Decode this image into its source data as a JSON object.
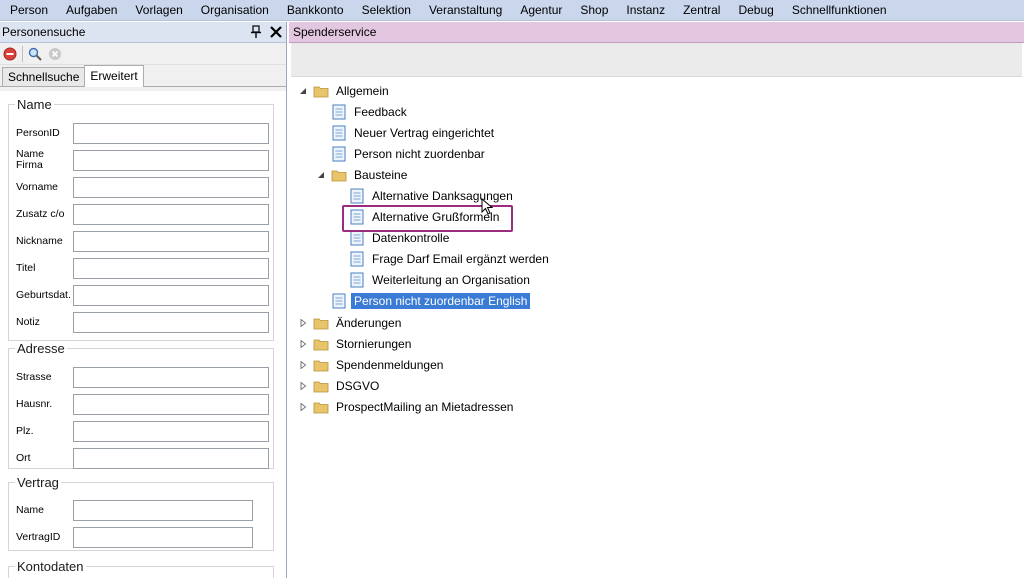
{
  "menu": [
    "Person",
    "Aufgaben",
    "Vorlagen",
    "Organisation",
    "Bankkonto",
    "Selektion",
    "Veranstaltung",
    "Agentur",
    "Shop",
    "Instanz",
    "Zentral",
    "Debug",
    "Schnellfunktionen"
  ],
  "left_panel": {
    "title": "Personensuche",
    "tabs": [
      "Schnellsuche",
      "Erweitert"
    ],
    "active_tab": "Erweitert",
    "groups": {
      "name": {
        "legend": "Name",
        "fields": [
          "PersonID",
          "Name Firma",
          "Vorname",
          "Zusatz c/o",
          "Nickname",
          "Titel",
          "Geburtsdat.",
          "Notiz"
        ]
      },
      "adresse": {
        "legend": "Adresse",
        "fields": [
          "Strasse",
          "Hausnr.",
          "Plz.",
          "Ort"
        ]
      },
      "vertrag": {
        "legend": "Vertrag",
        "fields": [
          "Name",
          "VertragID"
        ]
      },
      "kontodaten": {
        "legend": "Kontodaten"
      }
    }
  },
  "right_panel": {
    "title": "Spenderservice",
    "tree": {
      "allgemein": "Allgemein",
      "feedback": "Feedback",
      "neuer_vertrag": "Neuer Vertrag eingerichtet",
      "person_nicht": "Person nicht zuordenbar",
      "bausteine": "Bausteine",
      "alt_dank": "Alternative Danksagungen",
      "alt_gruss": "Alternative Grußformeln",
      "datenkontrolle": "Datenkontrolle",
      "frage_darf": "Frage Darf Email ergänzt werden",
      "weiterleitung": "Weiterleitung an Organisation",
      "person_nicht_en": "Person nicht zuordenbar English",
      "aenderungen": "Änderungen",
      "stornierungen": "Stornierungen",
      "spendenmeldungen": "Spendenmeldungen",
      "dsgvo": "DSGVO",
      "prospect": "ProspectMailing an Mietadressen"
    },
    "selected_item": "Person nicht zuordenbar English",
    "highlighted_item": "Alternative Grußformeln"
  },
  "colors": {
    "menubar": "#c9d6eb",
    "right_header": "#e3c6df",
    "selection": "#3a7bd5",
    "highlight_box": "#9b2d7f",
    "folder": "#e8c56a"
  }
}
